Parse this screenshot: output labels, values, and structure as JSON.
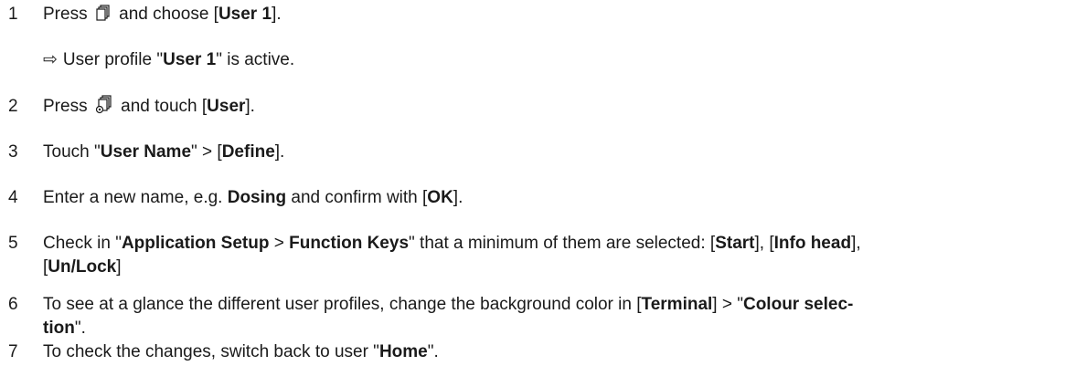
{
  "steps": [
    {
      "number": "1",
      "parts": [
        "Press",
        "and choose [",
        "User 1",
        "]."
      ]
    },
    {
      "result": [
        "User profile \"",
        "User 1",
        "\" is active."
      ]
    },
    {
      "number": "2",
      "parts": [
        "Press",
        "and touch [",
        "User",
        "]."
      ]
    },
    {
      "number": "3",
      "parts": [
        "Touch \"",
        "User Name",
        "\" > [",
        "Define",
        "]."
      ]
    },
    {
      "number": "4",
      "parts": [
        "Enter a new name, e.g. ",
        "Dosing",
        " and confirm with [",
        "OK",
        "]."
      ]
    },
    {
      "number": "5",
      "parts": [
        "Check in \"",
        "Application Setup",
        " > ",
        "Function Keys",
        "\" that a minimum of them are selected: [",
        "Start",
        "], [",
        "Info head",
        "],",
        "[",
        "Un/Lock",
        "]"
      ]
    },
    {
      "number": "6",
      "parts": [
        "To see at a glance the different user profiles, change the background color in [",
        "Terminal",
        "] > \"",
        "Colour selec-",
        "tion",
        "\"."
      ]
    },
    {
      "number": "7",
      "parts": [
        "To check the changes, switch back to user \"",
        "Home",
        "\"."
      ]
    }
  ],
  "icons": {
    "step1": "user-profiles-icon",
    "step2": "user-settings-icon",
    "result": "result-arrow-icon"
  }
}
